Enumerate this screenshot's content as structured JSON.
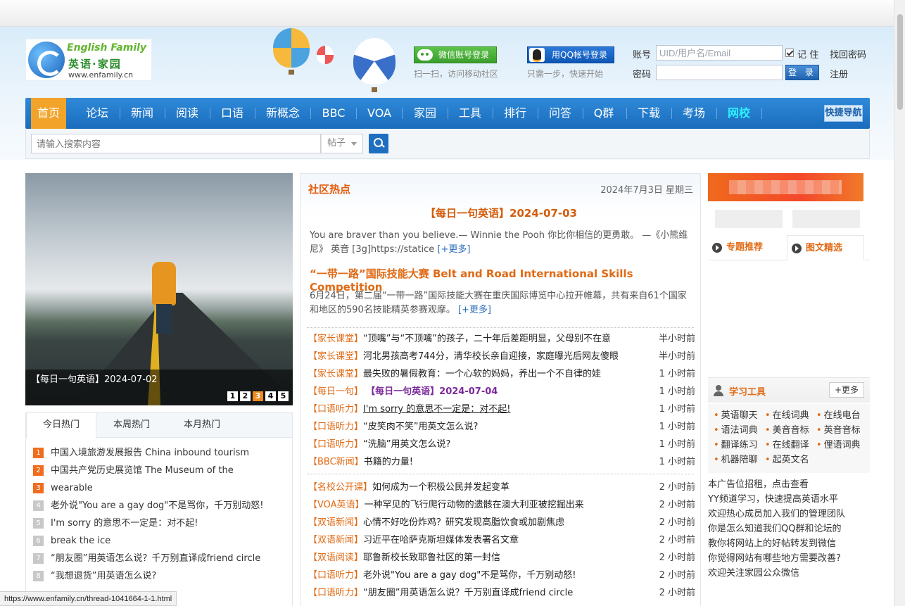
{
  "logo": {
    "en": "English Family",
    "cn": "英语·家园",
    "url": "www.enfamily.cn"
  },
  "social": {
    "wechat_label": "微信账号登录",
    "wechat_sub": "扫一扫，访问移动社区",
    "qq_label": "用QQ帐号登录",
    "qq_sub": "只需一步，快速开始"
  },
  "login": {
    "account_label": "账号",
    "account_placeholder": "UID/用户名/Email",
    "remember": "记 住",
    "forgot": "找回密码",
    "password_label": "密码",
    "login_btn": "登 录",
    "register": "注册"
  },
  "nav": {
    "items": [
      "首页",
      "论坛",
      "新闻",
      "阅读",
      "口语",
      "新概念",
      "BBC",
      "VOA",
      "家园",
      "工具",
      "排行",
      "问答",
      "Q群",
      "下载",
      "考场",
      "网校"
    ],
    "quick": "快捷导航"
  },
  "search": {
    "placeholder": "请输入搜索内容",
    "type": "帖子"
  },
  "slider": {
    "caption": "【每日一句英语】2024-07-02",
    "pages": [
      "1",
      "2",
      "3",
      "4",
      "5"
    ],
    "active": 3
  },
  "hot": {
    "tabs": [
      "今日热门",
      "本周热门",
      "本月热门"
    ],
    "items": [
      "中国入境旅游发展报告 China inbound tourism",
      "中国共产党历史展览馆 The Museum of the",
      "wearable",
      "老外说\"You are a gay dog\"不是骂你，千万别动怒!",
      "I'm sorry 的意思不一定是：对不起!",
      "break the ice",
      "“朋友圈”用英语怎么说？千万别直译成friend circle",
      "“我想退货”用英语怎么说?"
    ],
    "nums": [
      "1",
      "2",
      "3",
      "4",
      "5",
      "6",
      "7",
      "8"
    ]
  },
  "center": {
    "title": "社区热点",
    "date": "2024年7月3日 星期三",
    "headline1": "【每日一句英语】2024-07-03",
    "para1": "You are braver than you believe.— Winnie the Pooh 你比你相信的更勇敢。 —《小熊维尼》 英音 [3g]https://statice",
    "more": "[+更多]",
    "headline2": "“一带一路”国际技能大赛 Belt and Road International Skills Competition",
    "para2": "6月24日，第二届“一带一路”国际技能大赛在重庆国际博览中心拉开帷幕，共有来自61个国家和地区的590名技能精英参赛观摩。",
    "news": [
      {
        "cat": "【家长课堂】",
        "title": "“顶嘴”与“不顶嘴”的孩子，二十年后差距明显，父母别不在意",
        "time": "半小时前"
      },
      {
        "cat": "【家长课堂】",
        "title": "河北男孩高考744分，清华校长亲自迎接，家庭曝光后网友傻眼",
        "time": "半小时前"
      },
      {
        "cat": "【家长课堂】",
        "title": "最失败的暑假教育：一个心软的妈妈，养出一个不自律的娃",
        "time": "1 小时前"
      },
      {
        "cat": "【每日一句】",
        "title": "【每日一句英语】2024-07-04",
        "time": "1 小时前"
      },
      {
        "cat": "【口语听力】",
        "title": "I'm sorry 的意思不一定是：对不起!",
        "time": "1 小时前"
      },
      {
        "cat": "【口语听力】",
        "title": "“皮笑肉不笑”用英文怎么说?",
        "time": "1 小时前"
      },
      {
        "cat": "【口语听力】",
        "title": "“洗脑”用英文怎么说?",
        "time": "1 小时前"
      },
      {
        "cat": "【BBC新闻】",
        "title": "书籍的力量!",
        "time": "1 小时前"
      },
      {
        "cat": "【名校公开课】",
        "title": "如何成为一个积极公民并发起变革",
        "time": "2 小时前"
      },
      {
        "cat": "【VOA英语】",
        "title": "一种罕见的飞行爬行动物的遗骸在澳大利亚被挖掘出来",
        "time": "2 小时前"
      },
      {
        "cat": "【双语新闻】",
        "title": "心情不好吃份炸鸡？研究发现高脂饮食或加剧焦虑",
        "time": "2 小时前"
      },
      {
        "cat": "【双语新闻】",
        "title": "习近平在哈萨克斯坦媒体发表署名文章",
        "time": "2 小时前"
      },
      {
        "cat": "【双语阅读】",
        "title": "耶鲁新校长致耶鲁社区的第一封信",
        "time": "2 小时前"
      },
      {
        "cat": "【口语听力】",
        "title": "老外说\"You are a gay dog\"不是骂你，千万别动怒!",
        "time": "2 小时前"
      },
      {
        "cat": "【口语听力】",
        "title": "“朋友圈”用英语怎么说？千万别直译成friend circle",
        "time": "2 小时前"
      }
    ]
  },
  "right": {
    "tab1": "专题推荐",
    "tab2": "图文精选",
    "tools_title": "学习工具",
    "tools_more": "+更多",
    "tools": [
      "英语聊天",
      "在线词典",
      "在线电台",
      "语法词典",
      "美音音标",
      "英音音标",
      "翻译练习",
      "在线翻译",
      "俚语词典",
      "机器陪聊",
      "起英文名"
    ],
    "ads": [
      "本广告位招租，点击查看",
      "YY频道学习，快速提高英语水平",
      "欢迎热心成员加入我们的管理团队",
      "你是怎么知道我们QQ群和论坛的",
      "教你将网站上的好帖转发到微信",
      "你觉得网站有哪些地方需要改善?",
      "欢迎关注家园公众微信"
    ]
  },
  "statusbar": {
    "url": "https://www.enfamily.cn/thread-1041664-1-1.html"
  },
  "colors": {
    "nav": "#1a6cbd",
    "home_tab": "#f2a42a",
    "accent": "#e06a14"
  }
}
